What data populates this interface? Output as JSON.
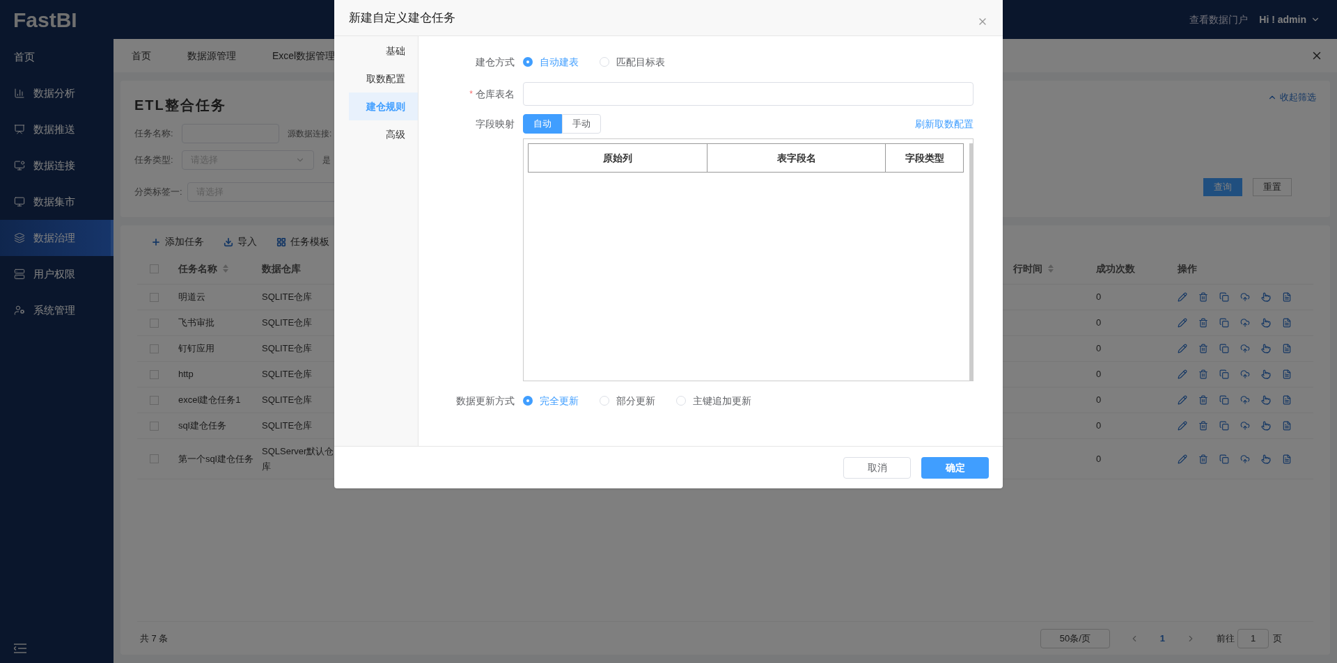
{
  "sidebar": {
    "logo": "FastBI",
    "items": [
      {
        "label": "首页",
        "selected": false
      },
      {
        "label": "数据分析",
        "selected": false
      },
      {
        "label": "数据推送",
        "selected": false
      },
      {
        "label": "数据连接",
        "selected": false
      },
      {
        "label": "数据集市",
        "selected": false
      },
      {
        "label": "数据治理",
        "selected": true
      },
      {
        "label": "用户权限",
        "selected": false
      },
      {
        "label": "系统管理",
        "selected": false
      }
    ]
  },
  "header": {
    "portal_link": "查看数据门户",
    "user": "Hi ! admin"
  },
  "tabs": [
    {
      "label": "首页"
    },
    {
      "label": "数据源管理"
    },
    {
      "label": "Excel数据管理"
    }
  ],
  "filter_panel": {
    "title": "ETL整合任务",
    "collapse_link": "收起筛选",
    "rows": [
      {
        "label": "任务名称:",
        "kind": "input",
        "trailing_label": "源数据连接:"
      },
      {
        "label": "任务类型:",
        "kind": "select",
        "placeholder": "请选择",
        "trailing_label": "是"
      },
      {
        "label": "分类标签一:",
        "kind": "select",
        "placeholder": "请选择"
      }
    ],
    "buttons": [
      {
        "label": "查询",
        "kind": "primary"
      },
      {
        "label": "重置",
        "kind": "default"
      }
    ]
  },
  "task_table": {
    "toolbar": [
      "添加任务",
      "导入",
      "任务模板"
    ],
    "columns": [
      "任务名称",
      "数据仓库",
      "行时间",
      "成功次数",
      "操作"
    ],
    "select_all_checked": false,
    "rows": [
      {
        "checked": false,
        "name": "明道云",
        "warehouse": "SQLITE仓库",
        "success_count": "0"
      },
      {
        "checked": false,
        "name": "飞书审批",
        "warehouse": "SQLITE仓库",
        "success_count": "0"
      },
      {
        "checked": false,
        "name": "钉钉应用",
        "warehouse": "SQLITE仓库",
        "success_count": "0"
      },
      {
        "checked": false,
        "name": "http",
        "warehouse": "SQLITE仓库",
        "success_count": "0"
      },
      {
        "checked": false,
        "name": "excel建仓任务1",
        "warehouse": "SQLITE仓库",
        "success_count": "0"
      },
      {
        "checked": false,
        "name": "sql建仓任务",
        "warehouse": "SQLITE仓库",
        "success_count": "0"
      },
      {
        "checked": false,
        "name": "第一个sql建仓任务",
        "warehouse": "SQLServer默认仓库",
        "success_count": "0"
      }
    ],
    "total": "共 7 条",
    "page_size": "50条/页",
    "current_page": "1",
    "goto_label": "前往",
    "goto_value": "1",
    "page_suffix": "页"
  },
  "dialog": {
    "title": "新建自定义建仓任务",
    "nav": [
      {
        "label": "基础",
        "selected": false
      },
      {
        "label": "取数配置",
        "selected": false
      },
      {
        "label": "建仓规则",
        "selected": true
      },
      {
        "label": "高级",
        "selected": false
      }
    ],
    "build_mode": {
      "label": "建仓方式",
      "options": [
        {
          "label": "自动建表",
          "selected": true
        },
        {
          "label": "匹配目标表",
          "selected": false
        }
      ]
    },
    "table_name": {
      "label": "仓库表名",
      "required_mark": "*"
    },
    "field_mapping": {
      "label": "字段映射",
      "modes": [
        {
          "label": "自动",
          "selected": true
        },
        {
          "label": "手动",
          "selected": false
        }
      ],
      "refresh_link": "刷新取数配置",
      "columns": [
        "原始列",
        "表字段名",
        "字段类型"
      ]
    },
    "update_mode": {
      "label": "数据更新方式",
      "options": [
        {
          "label": "完全更新",
          "selected": true
        },
        {
          "label": "部分更新",
          "selected": false
        },
        {
          "label": "主键追加更新",
          "selected": false
        }
      ]
    },
    "buttons": [
      {
        "label": "取消",
        "kind": "default"
      },
      {
        "label": "确定",
        "kind": "primary"
      }
    ]
  }
}
